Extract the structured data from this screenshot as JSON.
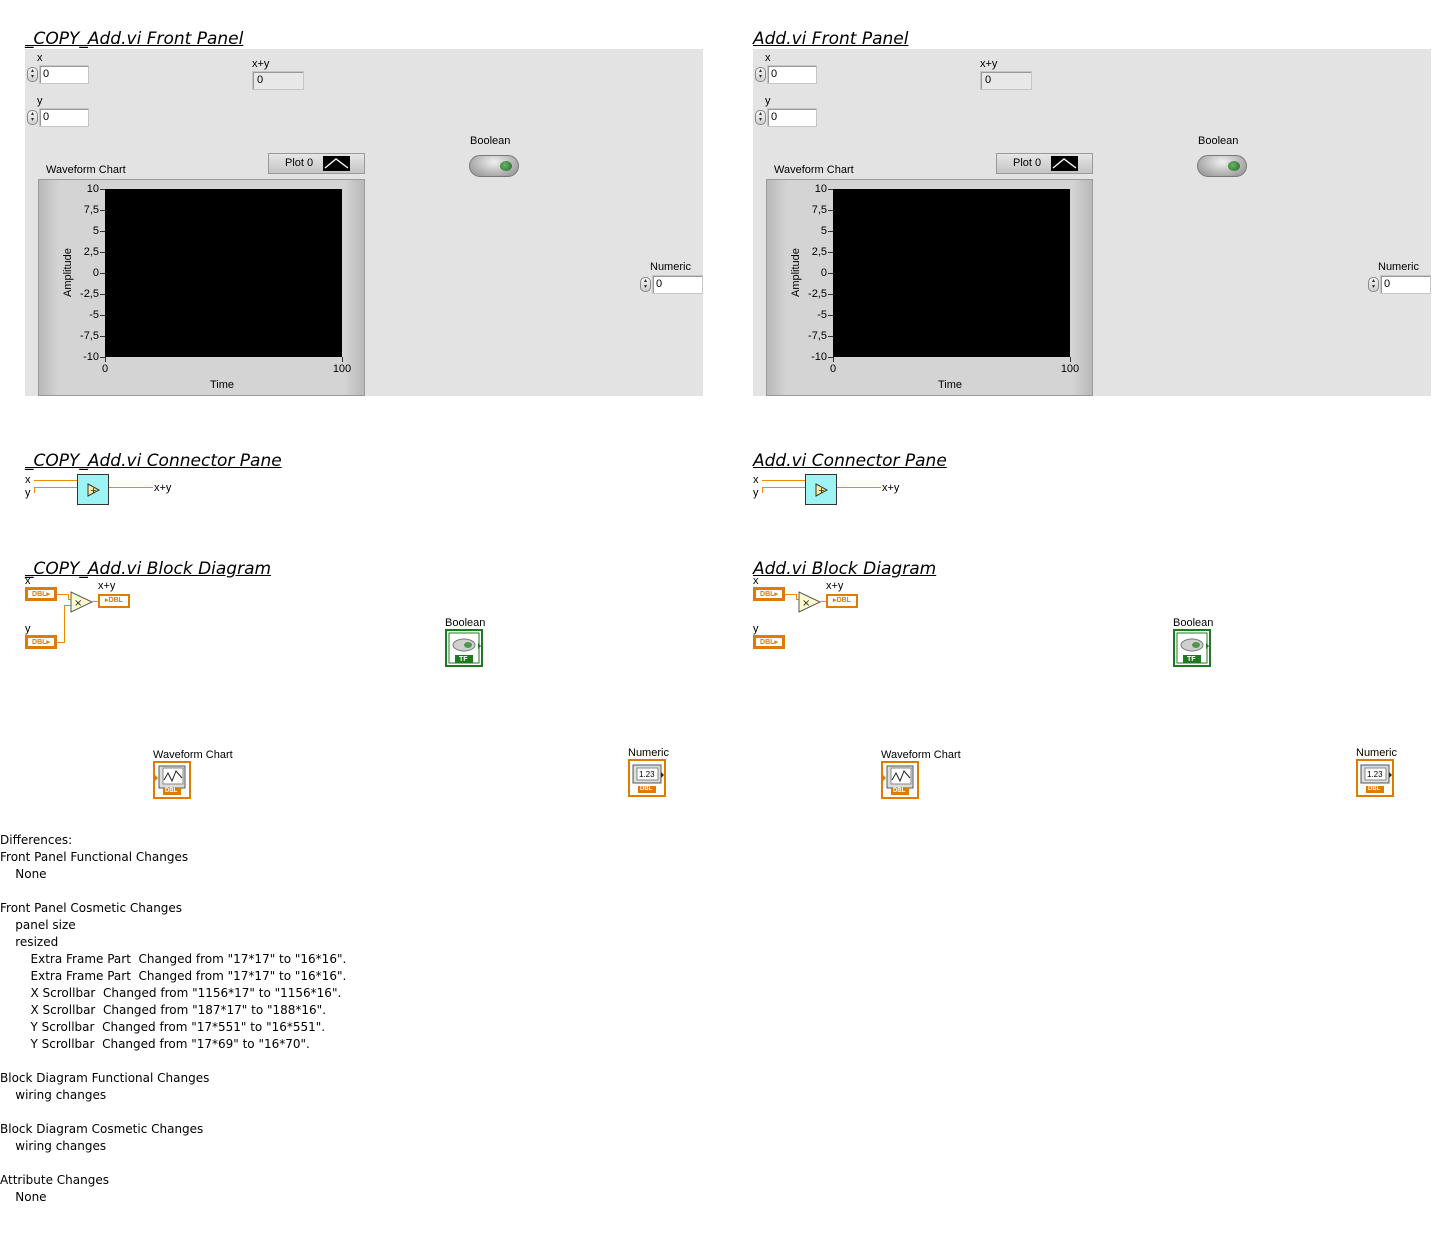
{
  "left": {
    "front_panel_title": "_COPY_Add.vi Front Panel",
    "connector_pane_title": "_COPY_Add.vi Connector Pane",
    "block_diagram_title": "_COPY_Add.vi Block Diagram"
  },
  "right": {
    "front_panel_title": "Add.vi Front Panel",
    "connector_pane_title": "Add.vi Connector Pane",
    "block_diagram_title": "Add.vi Block Diagram"
  },
  "front_panel": {
    "x_label": "x",
    "x_value": "0",
    "y_label": "y",
    "y_value": "0",
    "xy_label": "x+y",
    "xy_value": "0",
    "boolean_label": "Boolean",
    "numeric_label": "Numeric",
    "numeric_value": "0",
    "chart_label": "Waveform Chart",
    "legend_label": "Plot 0"
  },
  "chart_data": {
    "type": "line",
    "title": "Waveform Chart",
    "xlabel": "Time",
    "ylabel": "Amplitude",
    "xlim": [
      0,
      100
    ],
    "ylim": [
      -10,
      10
    ],
    "y_ticks": [
      "10",
      "7,5",
      "5",
      "2,5",
      "0",
      "-2,5",
      "-5",
      "-7,5",
      "-10"
    ],
    "x_ticks": [
      "0",
      "100"
    ],
    "series": [
      {
        "name": "Plot 0",
        "values": []
      }
    ],
    "plot_background": "#000000"
  },
  "connector_pane": {
    "x_label": "x",
    "y_label": "y",
    "out_label": "x+y"
  },
  "block_diagram": {
    "x_label": "x",
    "y_label": "y",
    "xy_label": "x+y",
    "boolean_label": "Boolean",
    "chart_label": "Waveform Chart",
    "numeric_label": "Numeric",
    "dbl": "DBL",
    "tf": "TF",
    "num_display": "1.23"
  },
  "differences": [
    "Differences:",
    "Front Panel Functional Changes",
    "    None",
    "",
    "Front Panel Cosmetic Changes",
    "    panel size",
    "    resized",
    "        Extra Frame Part  Changed from \"17*17\" to \"16*16\".",
    "        Extra Frame Part  Changed from \"17*17\" to \"16*16\".",
    "        X Scrollbar  Changed from \"1156*17\" to \"1156*16\".",
    "        X Scrollbar  Changed from \"187*17\" to \"188*16\".",
    "        Y Scrollbar  Changed from \"17*551\" to \"16*551\".",
    "        Y Scrollbar  Changed from \"17*69\" to \"16*70\".",
    "",
    "Block Diagram Functional Changes",
    "    wiring changes",
    "",
    "Block Diagram Cosmetic Changes",
    "    wiring changes",
    "",
    "Attribute Changes",
    "    None"
  ],
  "colors": {
    "panel_bg": "#e3e3e3",
    "wire_orange": "#f08a00",
    "boolean_green": "#1e7a1e",
    "connector_cyan": "#9ef4f4"
  }
}
